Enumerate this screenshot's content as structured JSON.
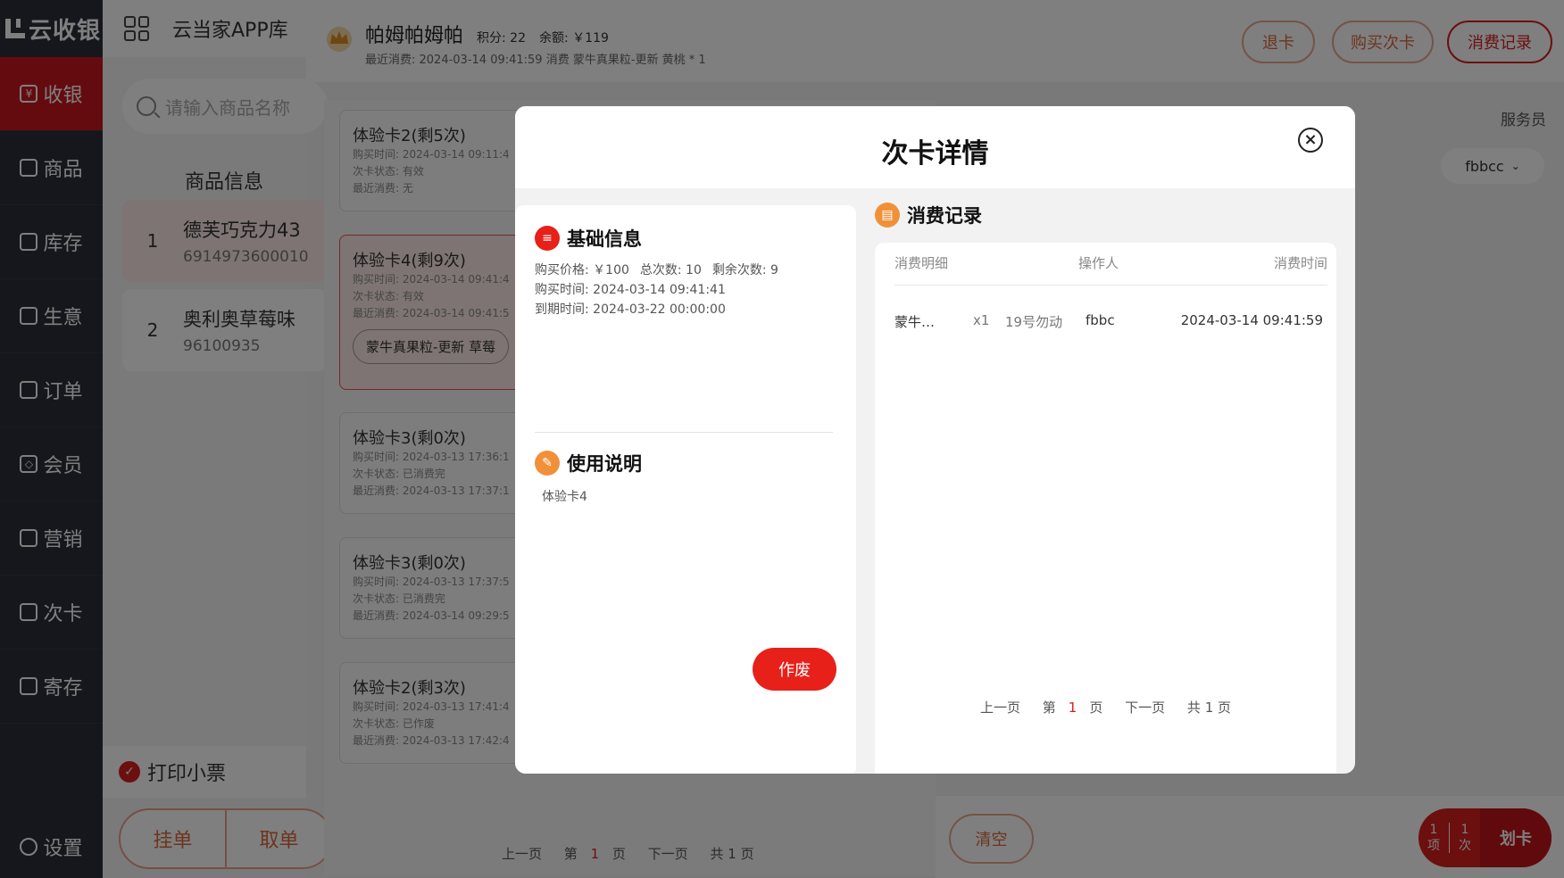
{
  "sidebar": {
    "logo": "云收银",
    "items": [
      {
        "label": "收银",
        "icon": "cashier-icon",
        "active": true
      },
      {
        "label": "商品",
        "icon": "box-icon"
      },
      {
        "label": "库存",
        "icon": "warehouse-icon"
      },
      {
        "label": "生意",
        "icon": "chart-icon"
      },
      {
        "label": "订单",
        "icon": "receipt-icon"
      },
      {
        "label": "会员",
        "icon": "diamond-icon"
      },
      {
        "label": "营销",
        "icon": "marketing-icon"
      },
      {
        "label": "次卡",
        "icon": "card-icon"
      },
      {
        "label": "寄存",
        "icon": "storage-icon"
      }
    ],
    "settings": "设置"
  },
  "left_panel": {
    "title": "云当家APP库",
    "search_placeholder": "请输入商品名称",
    "header": "商品信息",
    "products": [
      {
        "index": "1",
        "name": "德芙巧克力43",
        "code": "6914973600010"
      },
      {
        "index": "2",
        "name": "奥利奥草莓味",
        "code": "96100935"
      }
    ],
    "print_label": "打印小票",
    "hang_label": "挂单",
    "take_label": "取单"
  },
  "member": {
    "name": "帕姆帕姆帕",
    "points": "积分: 22",
    "balance": "余额: ￥119",
    "last": "最近消费: 2024-03-14 09:41:59 消费 蒙牛真果粒-更新 黄桃 * 1"
  },
  "top_buttons": {
    "refund": "退卡",
    "buy": "购买次卡",
    "records": "消费记录"
  },
  "cards": [
    {
      "title": "体验卡2(剩5次)",
      "l1": "购买时间: 2024-03-14 09:11:4",
      "l2": "次卡状态: 有效",
      "l3": "最近消费: 无"
    },
    {
      "title": "体验卡4(剩9次)",
      "l1": "购买时间: 2024-03-14 09:41:4",
      "l2": "次卡状态: 有效",
      "l3": "最近消费: 2024-03-14 09:41:5",
      "tag": "蒙牛真果粒-更新 草莓"
    },
    {
      "title": "体验卡3(剩0次)",
      "l1": "购买时间: 2024-03-13 17:36:1",
      "l2": "次卡状态: 已消费完",
      "l3": "最近消费: 2024-03-13 17:37:1"
    },
    {
      "title": "体验卡3(剩0次)",
      "l1": "购买时间: 2024-03-13 17:37:5",
      "l2": "次卡状态: 已消费完",
      "l3": "最近消费: 2024-03-14 09:29:5"
    },
    {
      "title": "体验卡2(剩3次)",
      "l1": "购买时间: 2024-03-13 17:41:4",
      "l2": "次卡状态: 已作废",
      "l3": "最近消费: 2024-03-13 17:42:4"
    }
  ],
  "bg_pager": {
    "prev": "上一页",
    "di": "第",
    "page": "1",
    "ye": "页",
    "next": "下一页",
    "total": "共 1 页"
  },
  "service": {
    "label": "服务员",
    "selected": "fbbcc"
  },
  "bottom": {
    "clear": "清空",
    "items_count": "1",
    "items_unit": "项",
    "times_count": "1",
    "times_unit": "次",
    "swipe": "划卡"
  },
  "modal": {
    "title": "次卡详情",
    "basic_title": "基础信息",
    "price": "购买价格: ￥100",
    "total": "总次数: 10",
    "remain": "剩余次数: 9",
    "buy_time": "购买时间: 2024-03-14 09:41:41",
    "expire_time": "到期时间: 2024-03-22 00:00:00",
    "usage_title": "使用说明",
    "usage_text": "体验卡4",
    "void_label": "作废",
    "records_title": "消费记录",
    "columns": {
      "detail": "消费明细",
      "operator": "操作人",
      "time": "消费时间"
    },
    "record": {
      "item": "蒙牛…",
      "qty": "x1",
      "note": "19号勿动",
      "operator": "fbbc",
      "time": "2024-03-14 09:41:59"
    },
    "pager": {
      "prev": "上一页",
      "di": "第",
      "page": "1",
      "ye": "页",
      "next": "下一页",
      "total": "共 1 页"
    }
  },
  "colors": {
    "accent": "#d81e1e",
    "sidebar": "#2b2f38",
    "orange": "#f0913a"
  }
}
